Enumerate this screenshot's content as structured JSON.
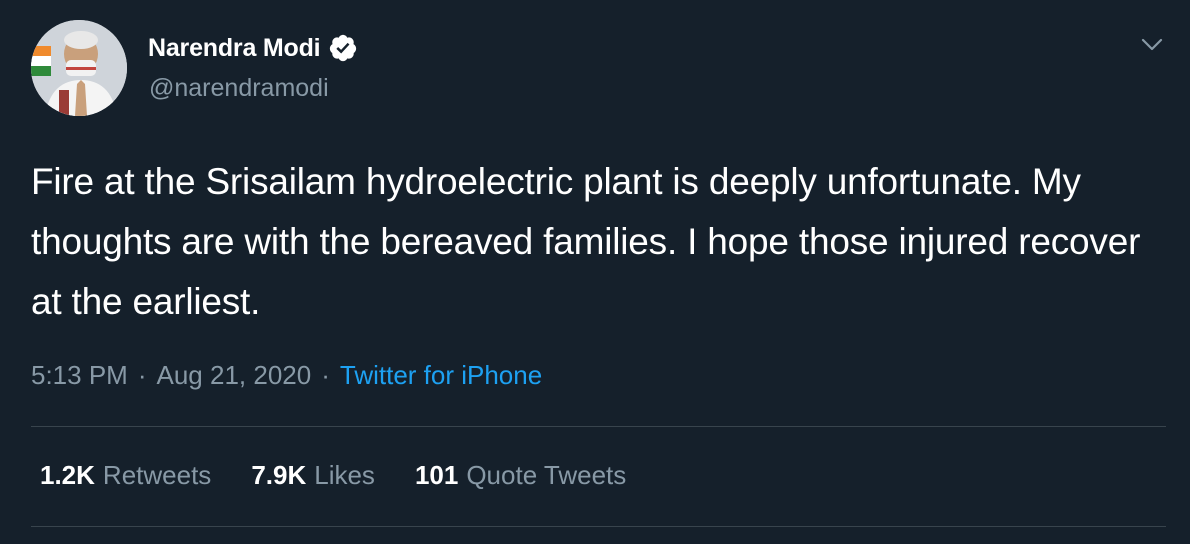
{
  "author": {
    "name": "Narendra Modi",
    "handle": "@narendramodi"
  },
  "tweet": {
    "text": "Fire at the Srisailam hydroelectric plant is deeply unfortunate. My thoughts are with the bereaved families. I hope those injured recover at the earliest.",
    "time": "5:13 PM",
    "date": "Aug 21, 2020",
    "separator": "·",
    "source": "Twitter for iPhone"
  },
  "stats": {
    "retweets": {
      "count": "1.2K",
      "label": "Retweets"
    },
    "likes": {
      "count": "7.9K",
      "label": "Likes"
    },
    "quotes": {
      "count": "101",
      "label": "Quote Tweets"
    }
  },
  "icons": {
    "verified": "verified-badge-icon",
    "menu": "chevron-down-icon"
  },
  "colors": {
    "background": "#15202b",
    "primary_text": "#ffffff",
    "secondary_text": "#8899a6",
    "accent": "#1da1f2",
    "divider": "#38444d"
  }
}
